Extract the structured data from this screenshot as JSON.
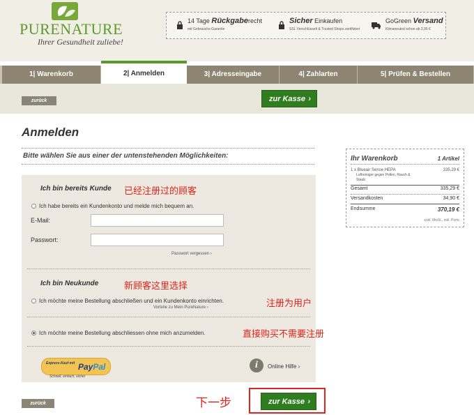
{
  "header": {
    "logo_text": "PURENATURE",
    "tagline": "Ihrer Gesundheit zuliebe!",
    "trust": [
      {
        "icon": "lock-icon",
        "line1_pre": "14 Tage ",
        "line1_bold": "Rückgabe",
        "line1_post": "recht",
        "line2": "mit Gebrauchs-Garantie"
      },
      {
        "icon": "lock-icon",
        "line1_pre": "",
        "line1_bold": "Sicher",
        "line1_post": " Einkaufen",
        "line2": "SSL Verschlüsselt & Trusted Shops zertifiziert"
      },
      {
        "icon": "truck-icon",
        "line1_pre": "GoGreen ",
        "line1_bold": "Versand",
        "line1_post": "",
        "line2": "Klimaneutral schon ab 2,95 €"
      }
    ]
  },
  "tabs": [
    {
      "label": "1| Warenkorb",
      "active": false
    },
    {
      "label": "2| Anmelden",
      "active": true
    },
    {
      "label": "3| Adresseingabe",
      "active": false
    },
    {
      "label": "4| Zahlarten",
      "active": false
    },
    {
      "label": "5| Prüfen & Bestellen",
      "active": false
    }
  ],
  "nav": {
    "back_label": "zurück",
    "checkout_label": "zur Kasse",
    "arrow": "›"
  },
  "page": {
    "title": "Anmelden",
    "instruction": "Bitte wählen Sie aus einer der untenstehenden Möglichkeiten:"
  },
  "existing": {
    "heading": "Ich bin bereits Kunde",
    "annotation_cn": "已经注册过的顾客",
    "radio_label": "Ich habe bereits ein Kundenkonto und melde mich bequem an.",
    "email_label": "E-Mail:",
    "email_value": "",
    "password_label": "Passwort:",
    "password_value": "",
    "forgot_label": "Passwort vergessen ›"
  },
  "newcustomer": {
    "heading": "Ich bin Neukunde",
    "annotation_cn": "新顾客这里选择",
    "register_label": "Ich möchte meine Bestellung abschließen und ein Kundenkonto einrichten.",
    "register_annotation_cn": "注册为用户",
    "advantages_label": "Vorteile zu Mein PureNature ›",
    "guest_label": "Ich möchte meine Bestellung abschliessen ohne mich anzumelden.",
    "guest_annotation_cn": "直接购买不需要注册",
    "guest_selected": true
  },
  "footer": {
    "paypal_top": "Express-Kauf mit",
    "paypal_brand_a": "Pay",
    "paypal_brand_b": "Pal",
    "paypal_sub": "Schnell, einfach, sicher",
    "help_label": "Online Hilfe ›",
    "next_annotation_cn": "下一步"
  },
  "cart": {
    "title": "Ihr Warenkorb",
    "count": "1 Artikel",
    "item_line": "1 x Blueair Sense HEPA",
    "item_desc": "Luftreiniger gegen Pollen, Rauch & Staub",
    "item_price": "335,29 €",
    "rows": [
      {
        "label": "Gesamt",
        "value": "335,29 €"
      },
      {
        "label": "Versandkosten",
        "value": "34,90 €"
      }
    ],
    "total_label": "Endsumme",
    "total_value": "370,19 €",
    "note": "exkl. MwSt., inkl. Porto"
  },
  "colors": {
    "brand_green": "#5f9a2e",
    "button_green": "#2f7d1e",
    "annotation_red": "#e2231a",
    "tab_bg": "#8d8472"
  }
}
